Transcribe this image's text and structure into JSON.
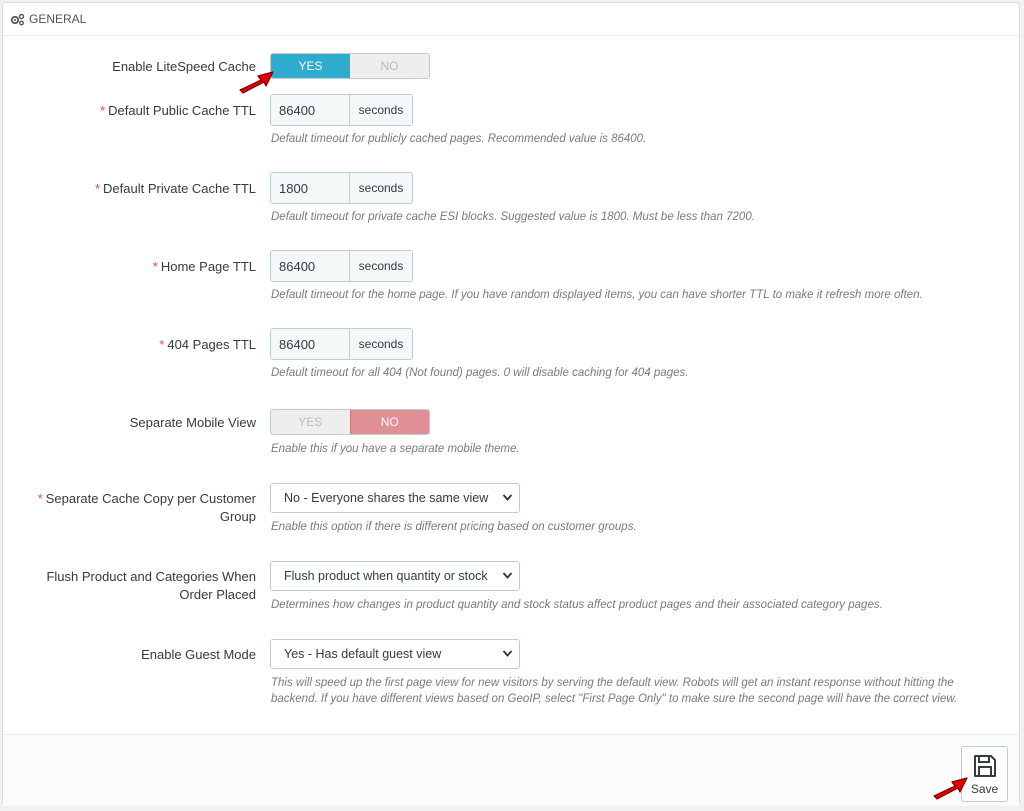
{
  "panel": {
    "title": "GENERAL"
  },
  "rows": {
    "enable_cache": {
      "label": "Enable LiteSpeed Cache",
      "yes": "YES",
      "no": "NO",
      "value": "YES"
    },
    "public_ttl": {
      "label": "Default Public Cache TTL",
      "value": "86400",
      "unit": "seconds",
      "help": "Default timeout for publicly cached pages. Recommended value is 86400."
    },
    "private_ttl": {
      "label": "Default Private Cache TTL",
      "value": "1800",
      "unit": "seconds",
      "help": "Default timeout for private cache ESI blocks. Suggested value is 1800. Must be less than 7200."
    },
    "home_ttl": {
      "label": "Home Page TTL",
      "value": "86400",
      "unit": "seconds",
      "help": "Default timeout for the home page. If you have random displayed items, you can have shorter TTL to make it refresh more often."
    },
    "ttl_404": {
      "label": "404 Pages TTL",
      "value": "86400",
      "unit": "seconds",
      "help": "Default timeout for all 404 (Not found) pages. 0 will disable caching for 404 pages."
    },
    "mobile_view": {
      "label": "Separate Mobile View",
      "yes": "YES",
      "no": "NO",
      "value": "NO",
      "help": "Enable this if you have a separate mobile theme."
    },
    "cache_per_group": {
      "label_line1": "Separate Cache Copy per Customer",
      "label_line2": "Group",
      "value": "No - Everyone shares the same view",
      "help": "Enable this option if there is different pricing based on customer groups."
    },
    "flush_product": {
      "label_line1": "Flush Product and Categories When",
      "label_line2": "Order Placed",
      "value": "Flush product when quantity or stock",
      "help": "Determines how changes in product quantity and stock status affect product pages and their associated category pages."
    },
    "guest_mode": {
      "label": "Enable Guest Mode",
      "value": "Yes - Has default guest view",
      "help_line1": "This will speed up the first page view for new visitors by serving the default view. Robots will get an instant response without hitting the",
      "help_line2": "backend. If you have different views based on GeoIP, select \"First Page Only\" to make sure the second page will have the correct view."
    }
  },
  "required_marker": "*",
  "footer": {
    "save_label": "Save"
  },
  "colors": {
    "accent": "#2eacce",
    "no_active": "#e08f95",
    "required": "#e24c4c",
    "arrow": "#e00000"
  },
  "icons": [
    "cogs-icon",
    "chevron-down-icon",
    "save-icon",
    "pointer-arrow-icon"
  ]
}
